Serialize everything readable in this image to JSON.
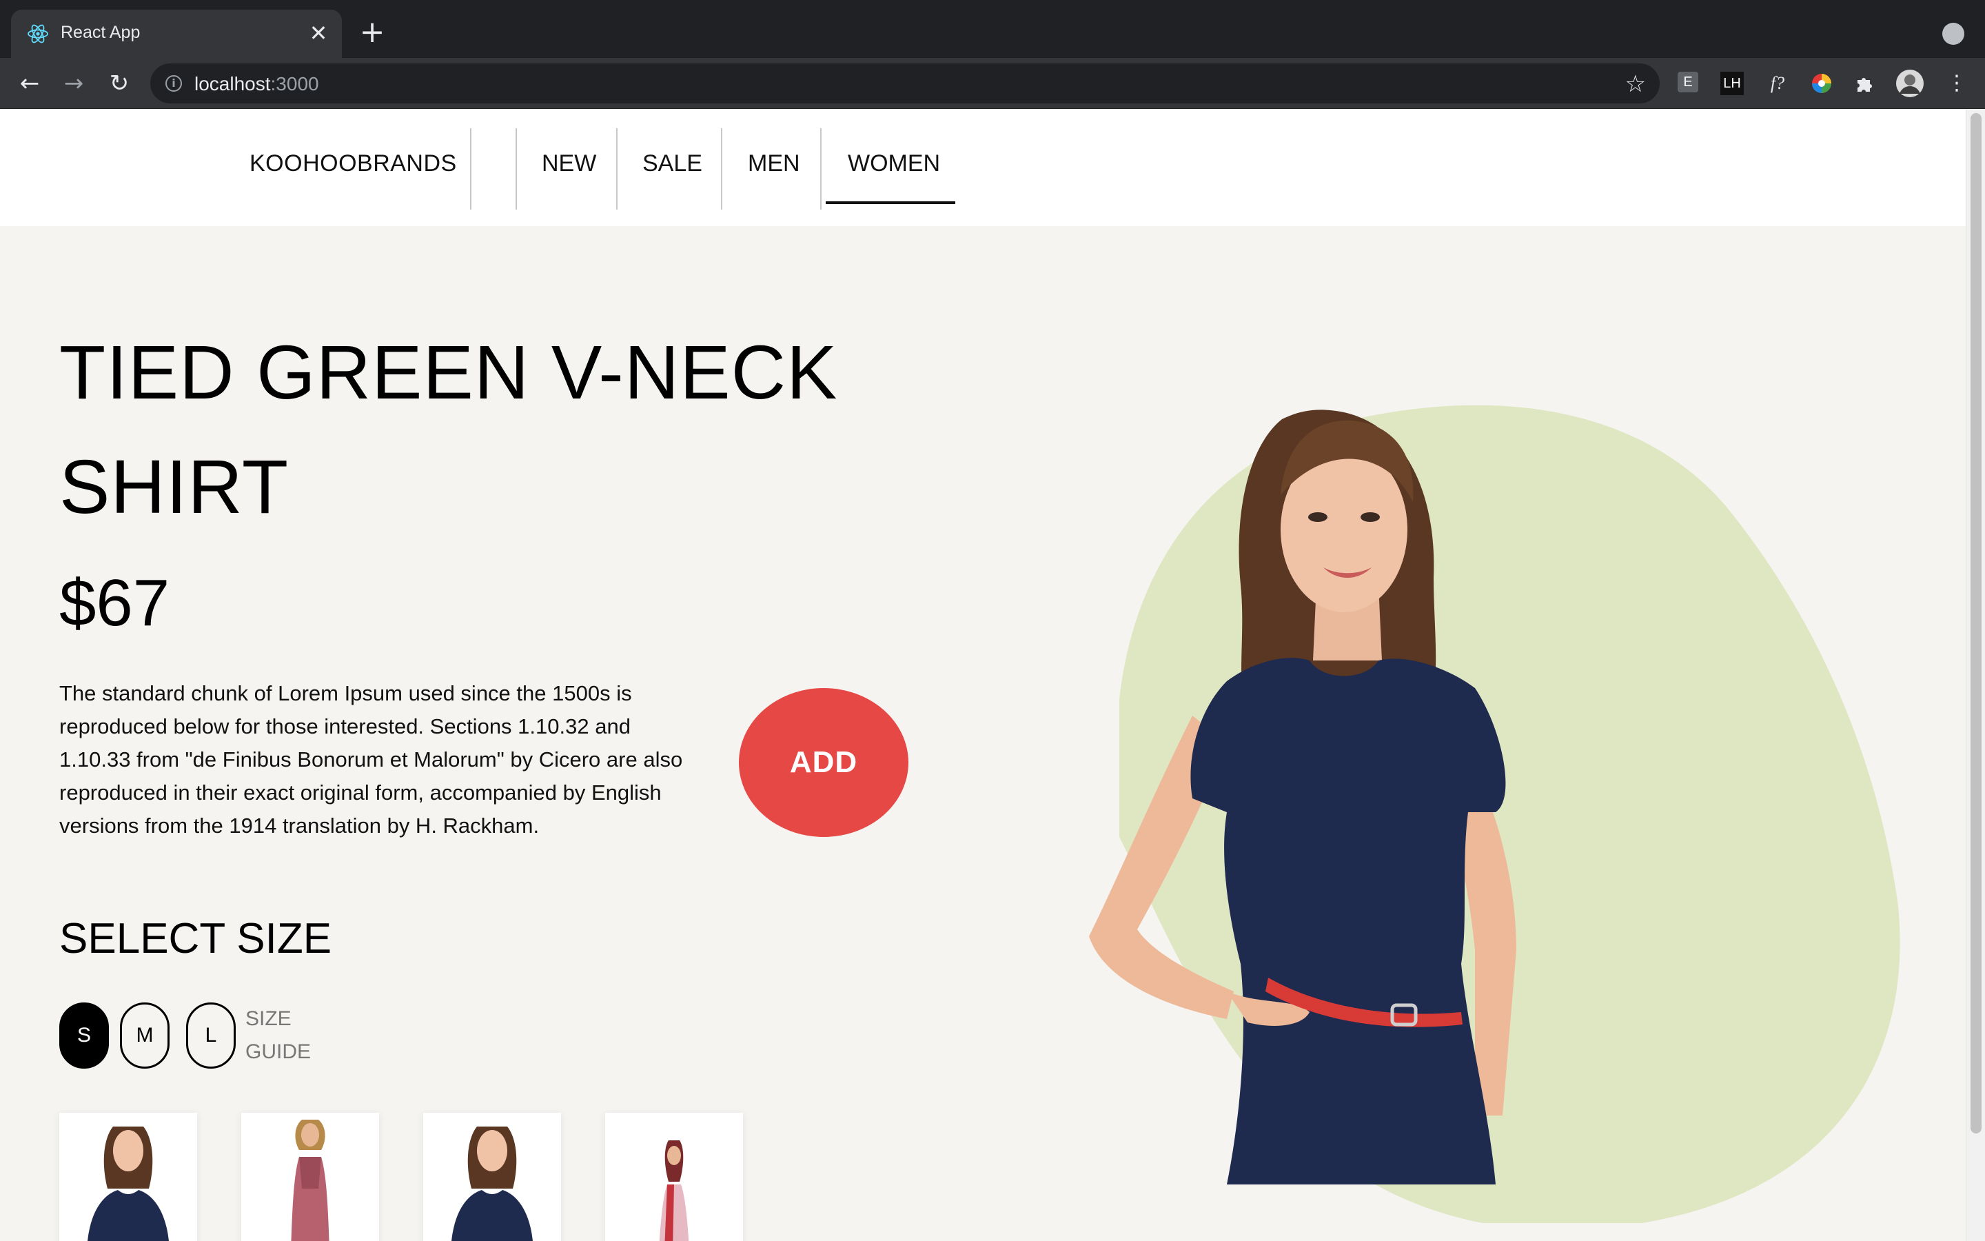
{
  "browser": {
    "tab_title": "React App",
    "tab_close": "✕",
    "new_tab": "+",
    "url_host": "localhost",
    "url_port": ":3000",
    "extensions": [
      "E",
      "LH",
      "f?"
    ]
  },
  "site": {
    "brand": "KOOHOOBRANDS",
    "nav": [
      "NEW",
      "SALE",
      "MEN",
      "WOMEN"
    ],
    "active_nav": "WOMEN"
  },
  "product": {
    "title_line1": "TIED GREEN V-NECK",
    "title_line2": "SHIRT",
    "price": "$67",
    "description": "The standard chunk of Lorem Ipsum used since the 1500s is reproduced below for those interested. Sections 1.10.32 and 1.10.33 from \"de Finibus Bonorum et Malorum\" by Cicero are also reproduced in their exact original form, accompanied by English versions from the 1914 translation by H. Rackham.",
    "add_label": "ADD",
    "select_size_label": "SELECT SIZE",
    "sizes": [
      "S",
      "M",
      "L"
    ],
    "selected_size": "S",
    "size_guide_line1": "SIZE",
    "size_guide_line2": "GUIDE"
  },
  "colors": {
    "accent_red": "#e54845",
    "blob_green": "#dfe7c2",
    "page_bg": "#f5f4f1"
  },
  "icons": {
    "back": "back-arrow-icon",
    "forward": "forward-arrow-icon",
    "reload": "reload-icon",
    "info": "info-icon",
    "bookmark": "star-icon",
    "extensions": "puzzle-icon",
    "menu": "kebab-menu-icon"
  }
}
